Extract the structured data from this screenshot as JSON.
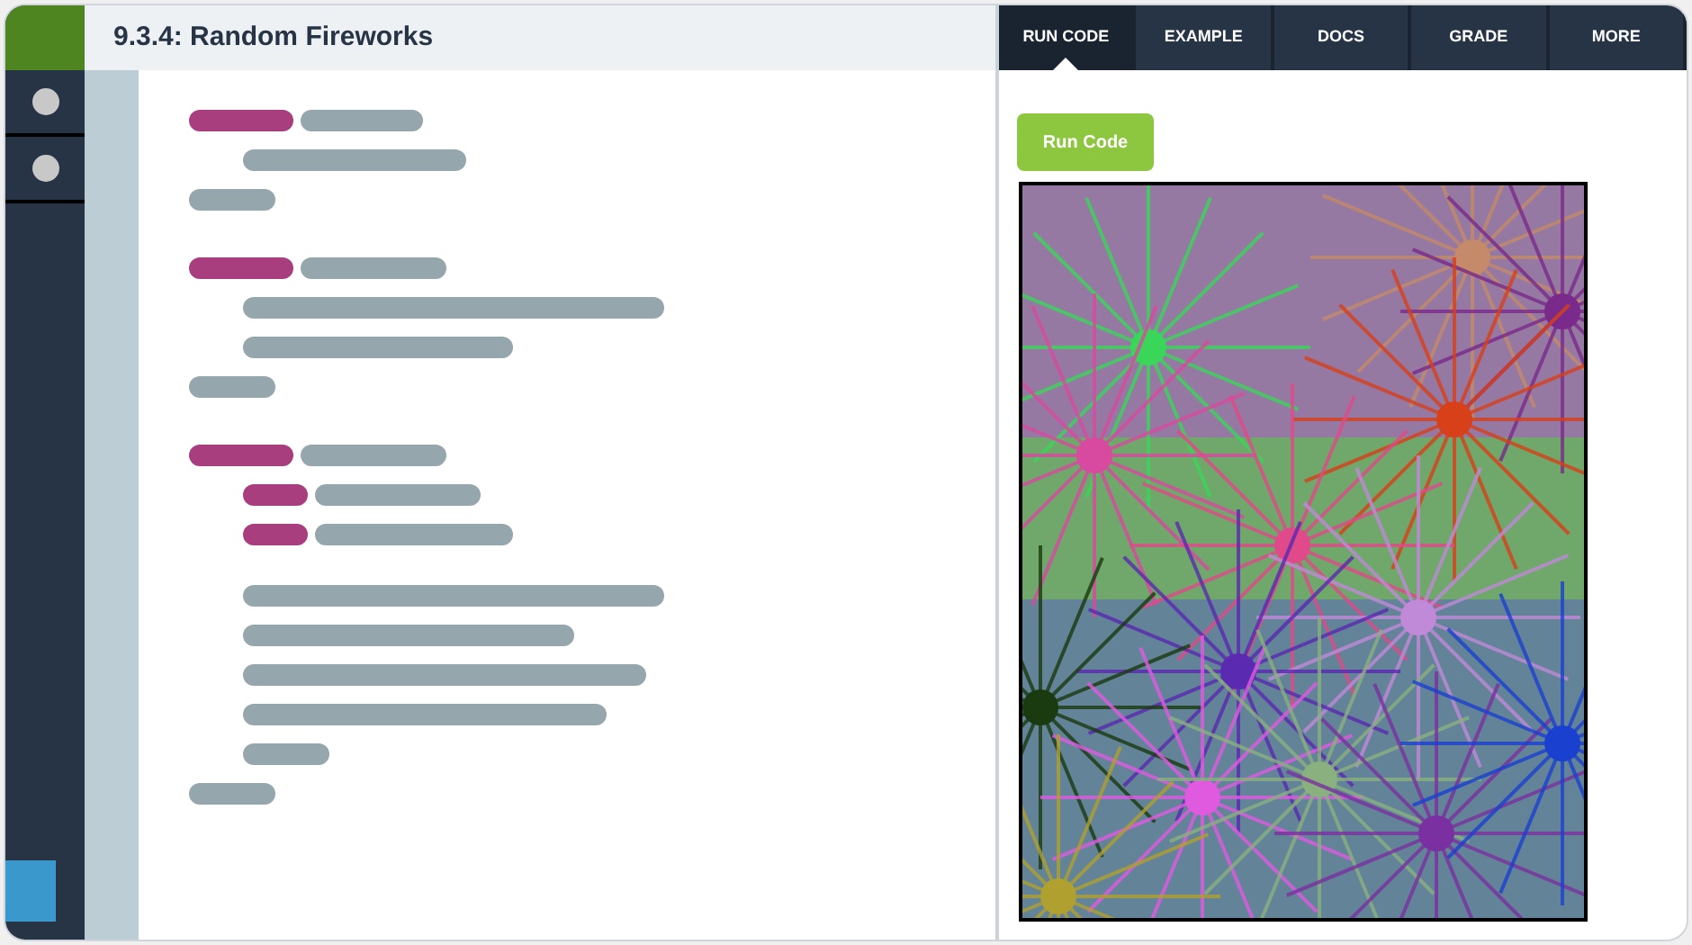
{
  "editor": {
    "title": "9.3.4: Random Fireworks"
  },
  "sidebar": {
    "items": [
      {
        "selected": false
      },
      {
        "selected": false
      }
    ]
  },
  "tabs": [
    {
      "label": "RUN CODE",
      "selected": true
    },
    {
      "label": "EXAMPLE",
      "selected": false
    },
    {
      "label": "DOCS",
      "selected": false
    },
    {
      "label": "GRADE",
      "selected": false
    },
    {
      "label": "MORE",
      "selected": false
    }
  ],
  "run_button": "Run Code"
}
